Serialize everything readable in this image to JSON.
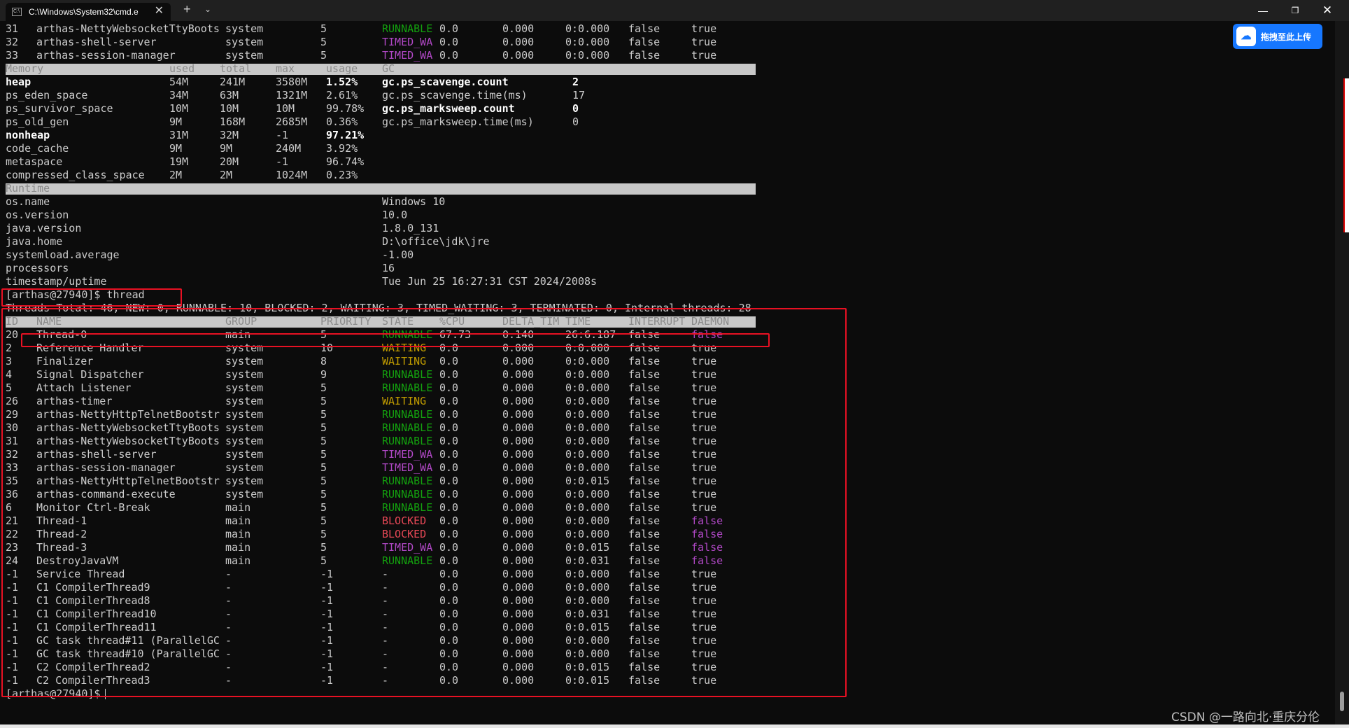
{
  "window": {
    "tab_title": "C:\\Windows\\System32\\cmd.e",
    "tab_icon_text": "C:\\",
    "close_tab": "✕",
    "new_tab": "+",
    "tab_menu": "⌄",
    "minimize": "—",
    "maximize": "❐",
    "close": "✕"
  },
  "upload_widget": {
    "label": "拖拽至此上传",
    "icon": "baidu-netdisk-icon",
    "color": "#1677ff"
  },
  "watermark": "CSDN @一路向北·重庆分伦",
  "columns": {
    "memory": [
      "Memory",
      "used",
      "total",
      "max",
      "usage",
      "GC"
    ],
    "runtime": [
      "Runtime"
    ],
    "threads": [
      "ID",
      "NAME",
      "GROUP",
      "PRIORITY",
      "STATE",
      "%CPU",
      "DELTA_TIM",
      "TIME",
      "INTERRUPT",
      "DAEMON"
    ]
  },
  "top_threads": [
    {
      "id": "31",
      "name": "arthas-NettyWebsocketTtyBoots",
      "group": "system",
      "priority": "5",
      "state": "RUNNABLE",
      "cpu": "0.0",
      "delta": "0.000",
      "time": "0:0.000",
      "interrupt": "false",
      "daemon": "true"
    },
    {
      "id": "32",
      "name": "arthas-shell-server",
      "group": "system",
      "priority": "5",
      "state": "TIMED_WA",
      "cpu": "0.0",
      "delta": "0.000",
      "time": "0:0.000",
      "interrupt": "false",
      "daemon": "true"
    },
    {
      "id": "33",
      "name": "arthas-session-manager",
      "group": "system",
      "priority": "5",
      "state": "TIMED_WA",
      "cpu": "0.0",
      "delta": "0.000",
      "time": "0:0.000",
      "interrupt": "false",
      "daemon": "true"
    }
  ],
  "memory": [
    {
      "name": "heap",
      "used": "54M",
      "total": "241M",
      "max": "3580M",
      "usage": "1.52%",
      "bold": true
    },
    {
      "name": "ps_eden_space",
      "used": "34M",
      "total": "63M",
      "max": "1321M",
      "usage": "2.61%",
      "bold": false
    },
    {
      "name": "ps_survivor_space",
      "used": "10M",
      "total": "10M",
      "max": "10M",
      "usage": "99.78%",
      "bold": false
    },
    {
      "name": "ps_old_gen",
      "used": "9M",
      "total": "168M",
      "max": "2685M",
      "usage": "0.36%",
      "bold": false
    },
    {
      "name": "nonheap",
      "used": "31M",
      "total": "32M",
      "max": "-1",
      "usage": "97.21%",
      "bold": true
    },
    {
      "name": "code_cache",
      "used": "9M",
      "total": "9M",
      "max": "240M",
      "usage": "3.92%",
      "bold": false
    },
    {
      "name": "metaspace",
      "used": "19M",
      "total": "20M",
      "max": "-1",
      "usage": "96.74%",
      "bold": false
    },
    {
      "name": "compressed_class_space",
      "used": "2M",
      "total": "2M",
      "max": "1024M",
      "usage": "0.23%",
      "bold": false
    }
  ],
  "gc": [
    {
      "name": "gc.ps_scavenge.count",
      "value": "2",
      "bold": true
    },
    {
      "name": "gc.ps_scavenge.time(ms)",
      "value": "17",
      "bold": false
    },
    {
      "name": "gc.ps_marksweep.count",
      "value": "0",
      "bold": true
    },
    {
      "name": "gc.ps_marksweep.time(ms)",
      "value": "0",
      "bold": false
    }
  ],
  "runtime": [
    {
      "key": "os.name",
      "value": "Windows 10"
    },
    {
      "key": "os.version",
      "value": "10.0"
    },
    {
      "key": "java.version",
      "value": "1.8.0_131"
    },
    {
      "key": "java.home",
      "value": "D:\\office\\jdk\\jre"
    },
    {
      "key": "systemload.average",
      "value": "-1.00"
    },
    {
      "key": "processors",
      "value": "16"
    },
    {
      "key": "timestamp/uptime",
      "value": "Tue Jun 25 16:27:31 CST 2024/2008s"
    }
  ],
  "command": "[arthas@27940]$ thread",
  "summary": "Threads Total: 46, NEW: 0, RUNNABLE: 10, BLOCKED: 2, WAITING: 3, TIMED_WAITING: 3, TERMINATED: 0, Internal threads: 28",
  "threads": [
    {
      "id": "20",
      "name": "Thread-0",
      "group": "main",
      "priority": "5",
      "state": "RUNNABLE",
      "cpu": "67.73",
      "delta": "0.140",
      "time": "26:6.187",
      "interrupt": "false",
      "daemon": "false"
    },
    {
      "id": "2",
      "name": "Reference Handler",
      "group": "system",
      "priority": "10",
      "state": "WAITING",
      "cpu": "0.0",
      "delta": "0.000",
      "time": "0:0.000",
      "interrupt": "false",
      "daemon": "true"
    },
    {
      "id": "3",
      "name": "Finalizer",
      "group": "system",
      "priority": "8",
      "state": "WAITING",
      "cpu": "0.0",
      "delta": "0.000",
      "time": "0:0.000",
      "interrupt": "false",
      "daemon": "true"
    },
    {
      "id": "4",
      "name": "Signal Dispatcher",
      "group": "system",
      "priority": "9",
      "state": "RUNNABLE",
      "cpu": "0.0",
      "delta": "0.000",
      "time": "0:0.000",
      "interrupt": "false",
      "daemon": "true"
    },
    {
      "id": "5",
      "name": "Attach Listener",
      "group": "system",
      "priority": "5",
      "state": "RUNNABLE",
      "cpu": "0.0",
      "delta": "0.000",
      "time": "0:0.000",
      "interrupt": "false",
      "daemon": "true"
    },
    {
      "id": "26",
      "name": "arthas-timer",
      "group": "system",
      "priority": "5",
      "state": "WAITING",
      "cpu": "0.0",
      "delta": "0.000",
      "time": "0:0.000",
      "interrupt": "false",
      "daemon": "true"
    },
    {
      "id": "29",
      "name": "arthas-NettyHttpTelnetBootstr",
      "group": "system",
      "priority": "5",
      "state": "RUNNABLE",
      "cpu": "0.0",
      "delta": "0.000",
      "time": "0:0.000",
      "interrupt": "false",
      "daemon": "true"
    },
    {
      "id": "30",
      "name": "arthas-NettyWebsocketTtyBoots",
      "group": "system",
      "priority": "5",
      "state": "RUNNABLE",
      "cpu": "0.0",
      "delta": "0.000",
      "time": "0:0.000",
      "interrupt": "false",
      "daemon": "true"
    },
    {
      "id": "31",
      "name": "arthas-NettyWebsocketTtyBoots",
      "group": "system",
      "priority": "5",
      "state": "RUNNABLE",
      "cpu": "0.0",
      "delta": "0.000",
      "time": "0:0.000",
      "interrupt": "false",
      "daemon": "true"
    },
    {
      "id": "32",
      "name": "arthas-shell-server",
      "group": "system",
      "priority": "5",
      "state": "TIMED_WA",
      "cpu": "0.0",
      "delta": "0.000",
      "time": "0:0.000",
      "interrupt": "false",
      "daemon": "true"
    },
    {
      "id": "33",
      "name": "arthas-session-manager",
      "group": "system",
      "priority": "5",
      "state": "TIMED_WA",
      "cpu": "0.0",
      "delta": "0.000",
      "time": "0:0.000",
      "interrupt": "false",
      "daemon": "true"
    },
    {
      "id": "35",
      "name": "arthas-NettyHttpTelnetBootstr",
      "group": "system",
      "priority": "5",
      "state": "RUNNABLE",
      "cpu": "0.0",
      "delta": "0.000",
      "time": "0:0.015",
      "interrupt": "false",
      "daemon": "true"
    },
    {
      "id": "36",
      "name": "arthas-command-execute",
      "group": "system",
      "priority": "5",
      "state": "RUNNABLE",
      "cpu": "0.0",
      "delta": "0.000",
      "time": "0:0.000",
      "interrupt": "false",
      "daemon": "true"
    },
    {
      "id": "6",
      "name": "Monitor Ctrl-Break",
      "group": "main",
      "priority": "5",
      "state": "RUNNABLE",
      "cpu": "0.0",
      "delta": "0.000",
      "time": "0:0.000",
      "interrupt": "false",
      "daemon": "true"
    },
    {
      "id": "21",
      "name": "Thread-1",
      "group": "main",
      "priority": "5",
      "state": "BLOCKED",
      "cpu": "0.0",
      "delta": "0.000",
      "time": "0:0.000",
      "interrupt": "false",
      "daemon": "false"
    },
    {
      "id": "22",
      "name": "Thread-2",
      "group": "main",
      "priority": "5",
      "state": "BLOCKED",
      "cpu": "0.0",
      "delta": "0.000",
      "time": "0:0.000",
      "interrupt": "false",
      "daemon": "false"
    },
    {
      "id": "23",
      "name": "Thread-3",
      "group": "main",
      "priority": "5",
      "state": "TIMED_WA",
      "cpu": "0.0",
      "delta": "0.000",
      "time": "0:0.015",
      "interrupt": "false",
      "daemon": "false"
    },
    {
      "id": "24",
      "name": "DestroyJavaVM",
      "group": "main",
      "priority": "5",
      "state": "RUNNABLE",
      "cpu": "0.0",
      "delta": "0.000",
      "time": "0:0.031",
      "interrupt": "false",
      "daemon": "false"
    },
    {
      "id": "-1",
      "name": "Service Thread",
      "group": "-",
      "priority": "-1",
      "state": "-",
      "cpu": "0.0",
      "delta": "0.000",
      "time": "0:0.000",
      "interrupt": "false",
      "daemon": "true"
    },
    {
      "id": "-1",
      "name": "C1 CompilerThread9",
      "group": "-",
      "priority": "-1",
      "state": "-",
      "cpu": "0.0",
      "delta": "0.000",
      "time": "0:0.000",
      "interrupt": "false",
      "daemon": "true"
    },
    {
      "id": "-1",
      "name": "C1 CompilerThread8",
      "group": "-",
      "priority": "-1",
      "state": "-",
      "cpu": "0.0",
      "delta": "0.000",
      "time": "0:0.000",
      "interrupt": "false",
      "daemon": "true"
    },
    {
      "id": "-1",
      "name": "C1 CompilerThread10",
      "group": "-",
      "priority": "-1",
      "state": "-",
      "cpu": "0.0",
      "delta": "0.000",
      "time": "0:0.031",
      "interrupt": "false",
      "daemon": "true"
    },
    {
      "id": "-1",
      "name": "C1 CompilerThread11",
      "group": "-",
      "priority": "-1",
      "state": "-",
      "cpu": "0.0",
      "delta": "0.000",
      "time": "0:0.015",
      "interrupt": "false",
      "daemon": "true"
    },
    {
      "id": "-1",
      "name": "GC task thread#11 (ParallelGC",
      "group": "-",
      "priority": "-1",
      "state": "-",
      "cpu": "0.0",
      "delta": "0.000",
      "time": "0:0.000",
      "interrupt": "false",
      "daemon": "true"
    },
    {
      "id": "-1",
      "name": "GC task thread#10 (ParallelGC",
      "group": "-",
      "priority": "-1",
      "state": "-",
      "cpu": "0.0",
      "delta": "0.000",
      "time": "0:0.000",
      "interrupt": "false",
      "daemon": "true"
    },
    {
      "id": "-1",
      "name": "C2 CompilerThread2",
      "group": "-",
      "priority": "-1",
      "state": "-",
      "cpu": "0.0",
      "delta": "0.000",
      "time": "0:0.015",
      "interrupt": "false",
      "daemon": "true"
    },
    {
      "id": "-1",
      "name": "C2 CompilerThread3",
      "group": "-",
      "priority": "-1",
      "state": "-",
      "cpu": "0.0",
      "delta": "0.000",
      "time": "0:0.015",
      "interrupt": "false",
      "daemon": "true"
    }
  ],
  "prompt": "[arthas@27940]$ ",
  "colors": {
    "runnable": "#13a10e",
    "timed_waiting": "#b148c6",
    "waiting": "#c19c00",
    "blocked": "#e74856",
    "daemon_false": "#b148c6",
    "highlight_box": "#e81123"
  }
}
